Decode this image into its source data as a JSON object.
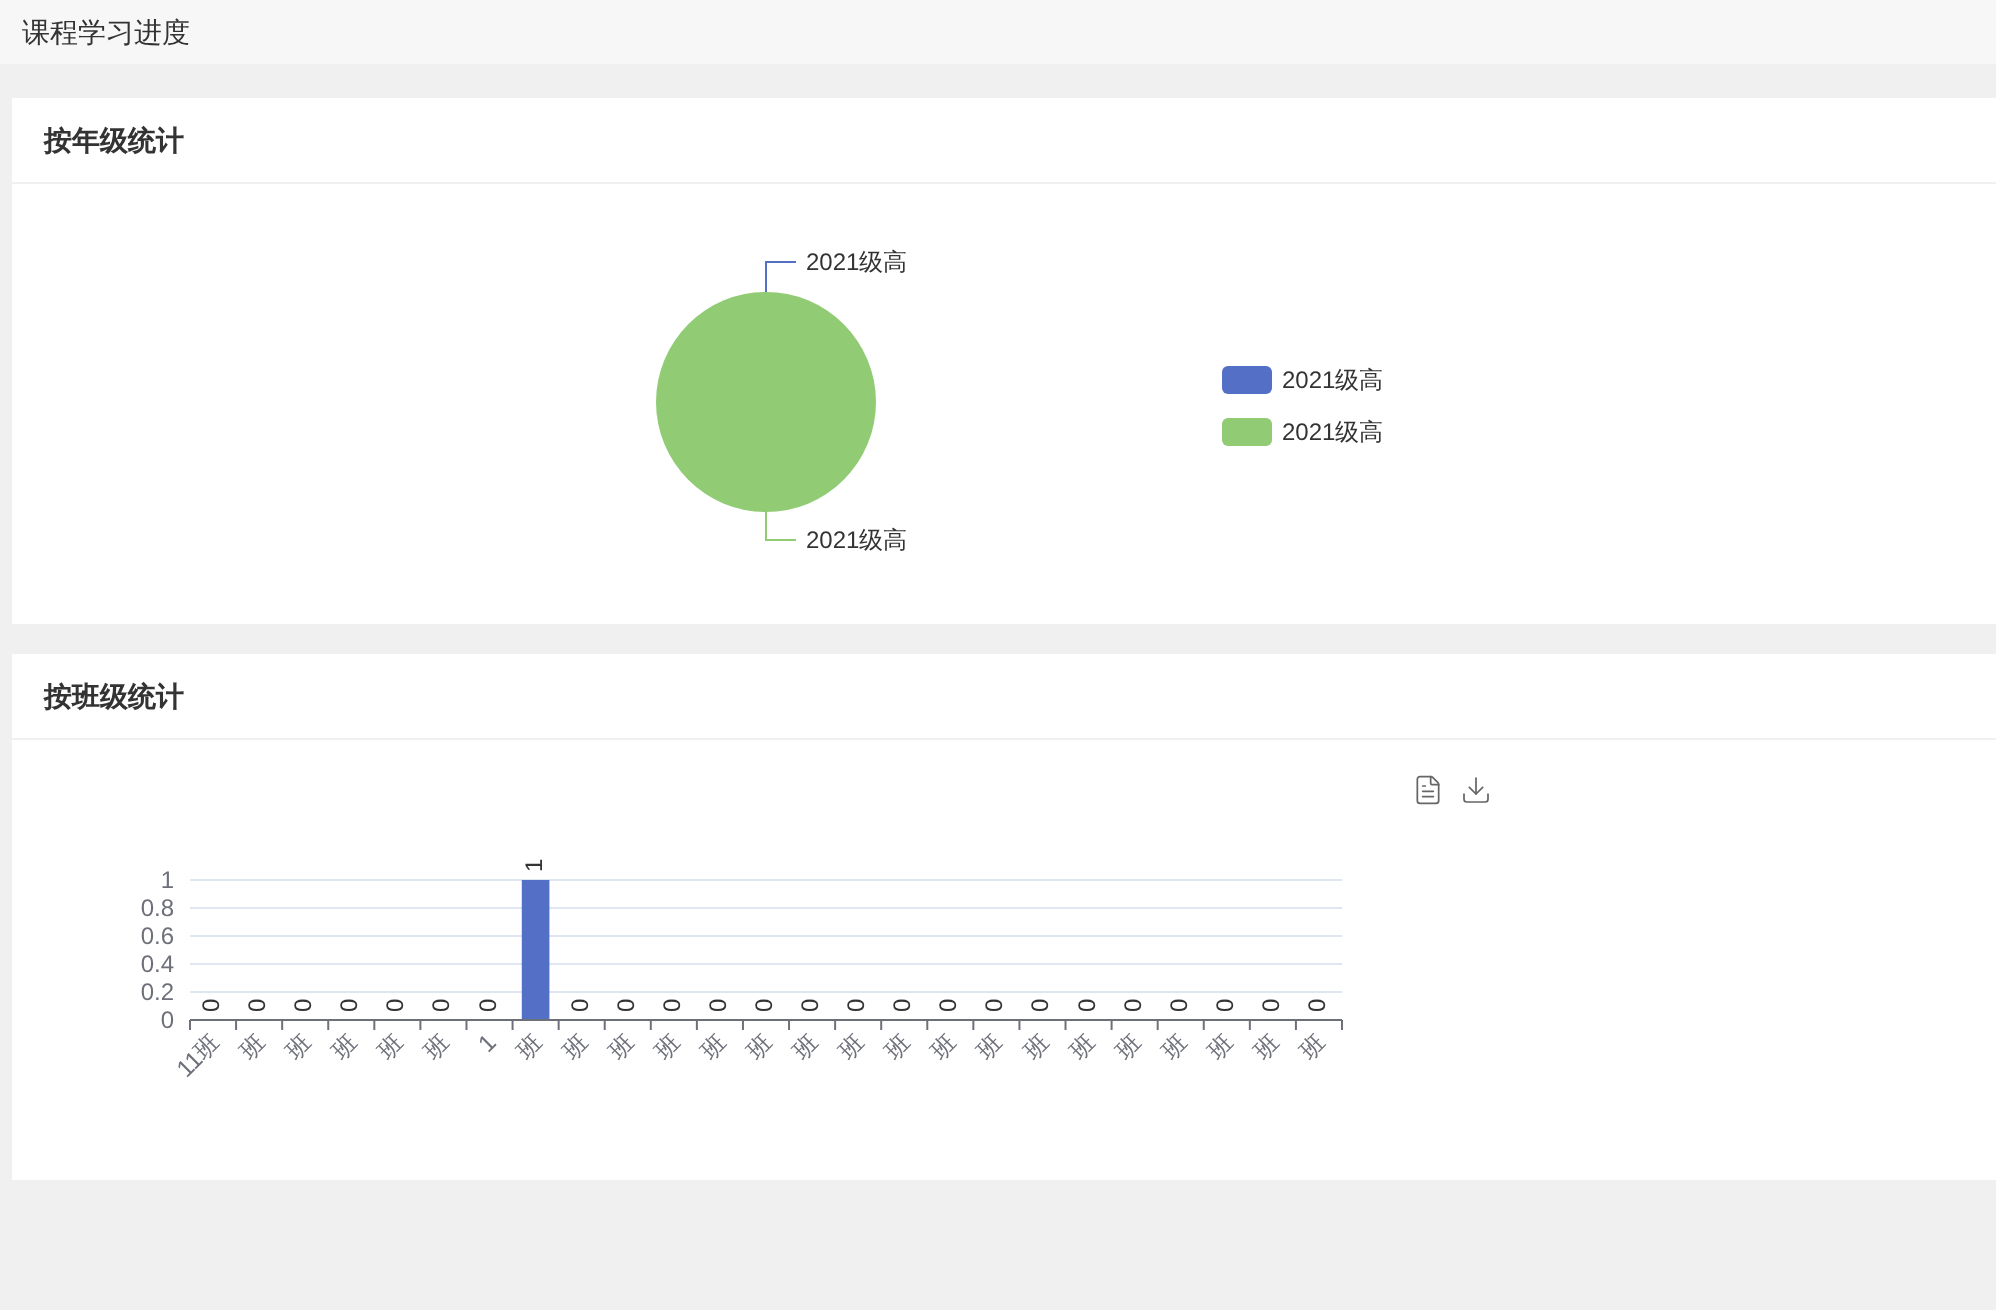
{
  "page_title": "课程学习进度",
  "grade_card": {
    "title": "按年级统计",
    "chart_data": {
      "type": "pie",
      "categories": [
        "2021级高",
        "2021级高"
      ],
      "series": [
        {
          "values": [
            0,
            1
          ]
        }
      ]
    },
    "legend": [
      {
        "label": "2021级高",
        "color": "#5470c6"
      },
      {
        "label": "2021级高",
        "color": "#91cc75"
      }
    ]
  },
  "class_card": {
    "title": "按班级统计",
    "chart_data": {
      "type": "bar",
      "categories": [
        "11班",
        "班",
        "班",
        "班",
        "班",
        "班",
        "1",
        "班",
        "班",
        "班",
        "班",
        "班",
        "班",
        "班",
        "班",
        "班",
        "班",
        "班",
        "班",
        "班",
        "班",
        "班",
        "班",
        "班",
        "班"
      ],
      "series": [
        {
          "color": "#5470c6",
          "values": [
            0,
            0,
            0,
            0,
            0,
            0,
            0,
            1,
            0,
            0,
            0,
            0,
            0,
            0,
            0,
            0,
            0,
            0,
            0,
            0,
            0,
            0,
            0,
            0,
            0
          ]
        }
      ],
      "yticks": [
        0,
        0.2,
        0.4,
        0.6,
        0.8,
        1
      ],
      "ylim": [
        0,
        1
      ],
      "grid": true,
      "data_labels": true
    }
  }
}
